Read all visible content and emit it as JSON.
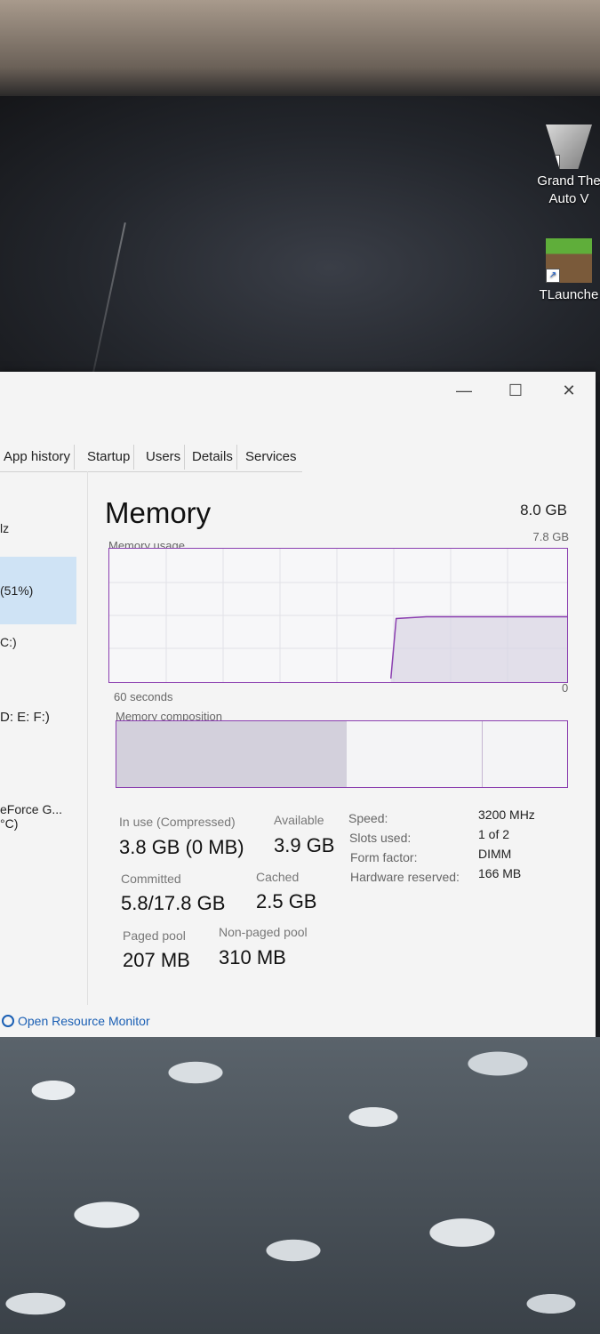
{
  "desktop": {
    "icons": [
      {
        "label": "Grand The\nAuto V"
      },
      {
        "label": "TLaunche"
      }
    ]
  },
  "window": {
    "controls": {
      "minimize": "—",
      "maximize": "☐",
      "close": "✕"
    },
    "tabs": [
      "App history",
      "Startup",
      "Users",
      "Details",
      "Services"
    ],
    "sidebar": [
      {
        "text": "lz"
      },
      {
        "text": "(51%)",
        "selected": true
      },
      {
        "text": "C:)"
      },
      {
        "text": "D: E: F:)"
      },
      {
        "text": "eForce G...\n°C)"
      }
    ],
    "memory": {
      "title": "Memory",
      "total": "8.0 GB",
      "usage_label": "Memory usage",
      "usage_max": "7.8 GB",
      "time_label": "60 seconds",
      "zero_label": "0",
      "composition_label": "Memory composition",
      "usage_fraction": 0.49,
      "composition": {
        "in_use_fraction": 0.51,
        "standby_fraction": 0.3
      }
    },
    "stats": {
      "in_use": {
        "label": "In use (Compressed)",
        "value": "3.8 GB (0 MB)"
      },
      "available": {
        "label": "Available",
        "value": "3.9 GB"
      },
      "committed": {
        "label": "Committed",
        "value": "5.8/17.8 GB"
      },
      "cached": {
        "label": "Cached",
        "value": "2.5 GB"
      },
      "paged_pool": {
        "label": "Paged pool",
        "value": "207 MB"
      },
      "non_paged_pool": {
        "label": "Non-paged pool",
        "value": "310 MB"
      }
    },
    "details": [
      {
        "label": "Speed:",
        "value": "3200 MHz"
      },
      {
        "label": "Slots used:",
        "value": "1 of 2"
      },
      {
        "label": "Form factor:",
        "value": "DIMM"
      },
      {
        "label": "Hardware reserved:",
        "value": "166 MB"
      }
    ],
    "footer_link": "Open Resource Monitor"
  }
}
